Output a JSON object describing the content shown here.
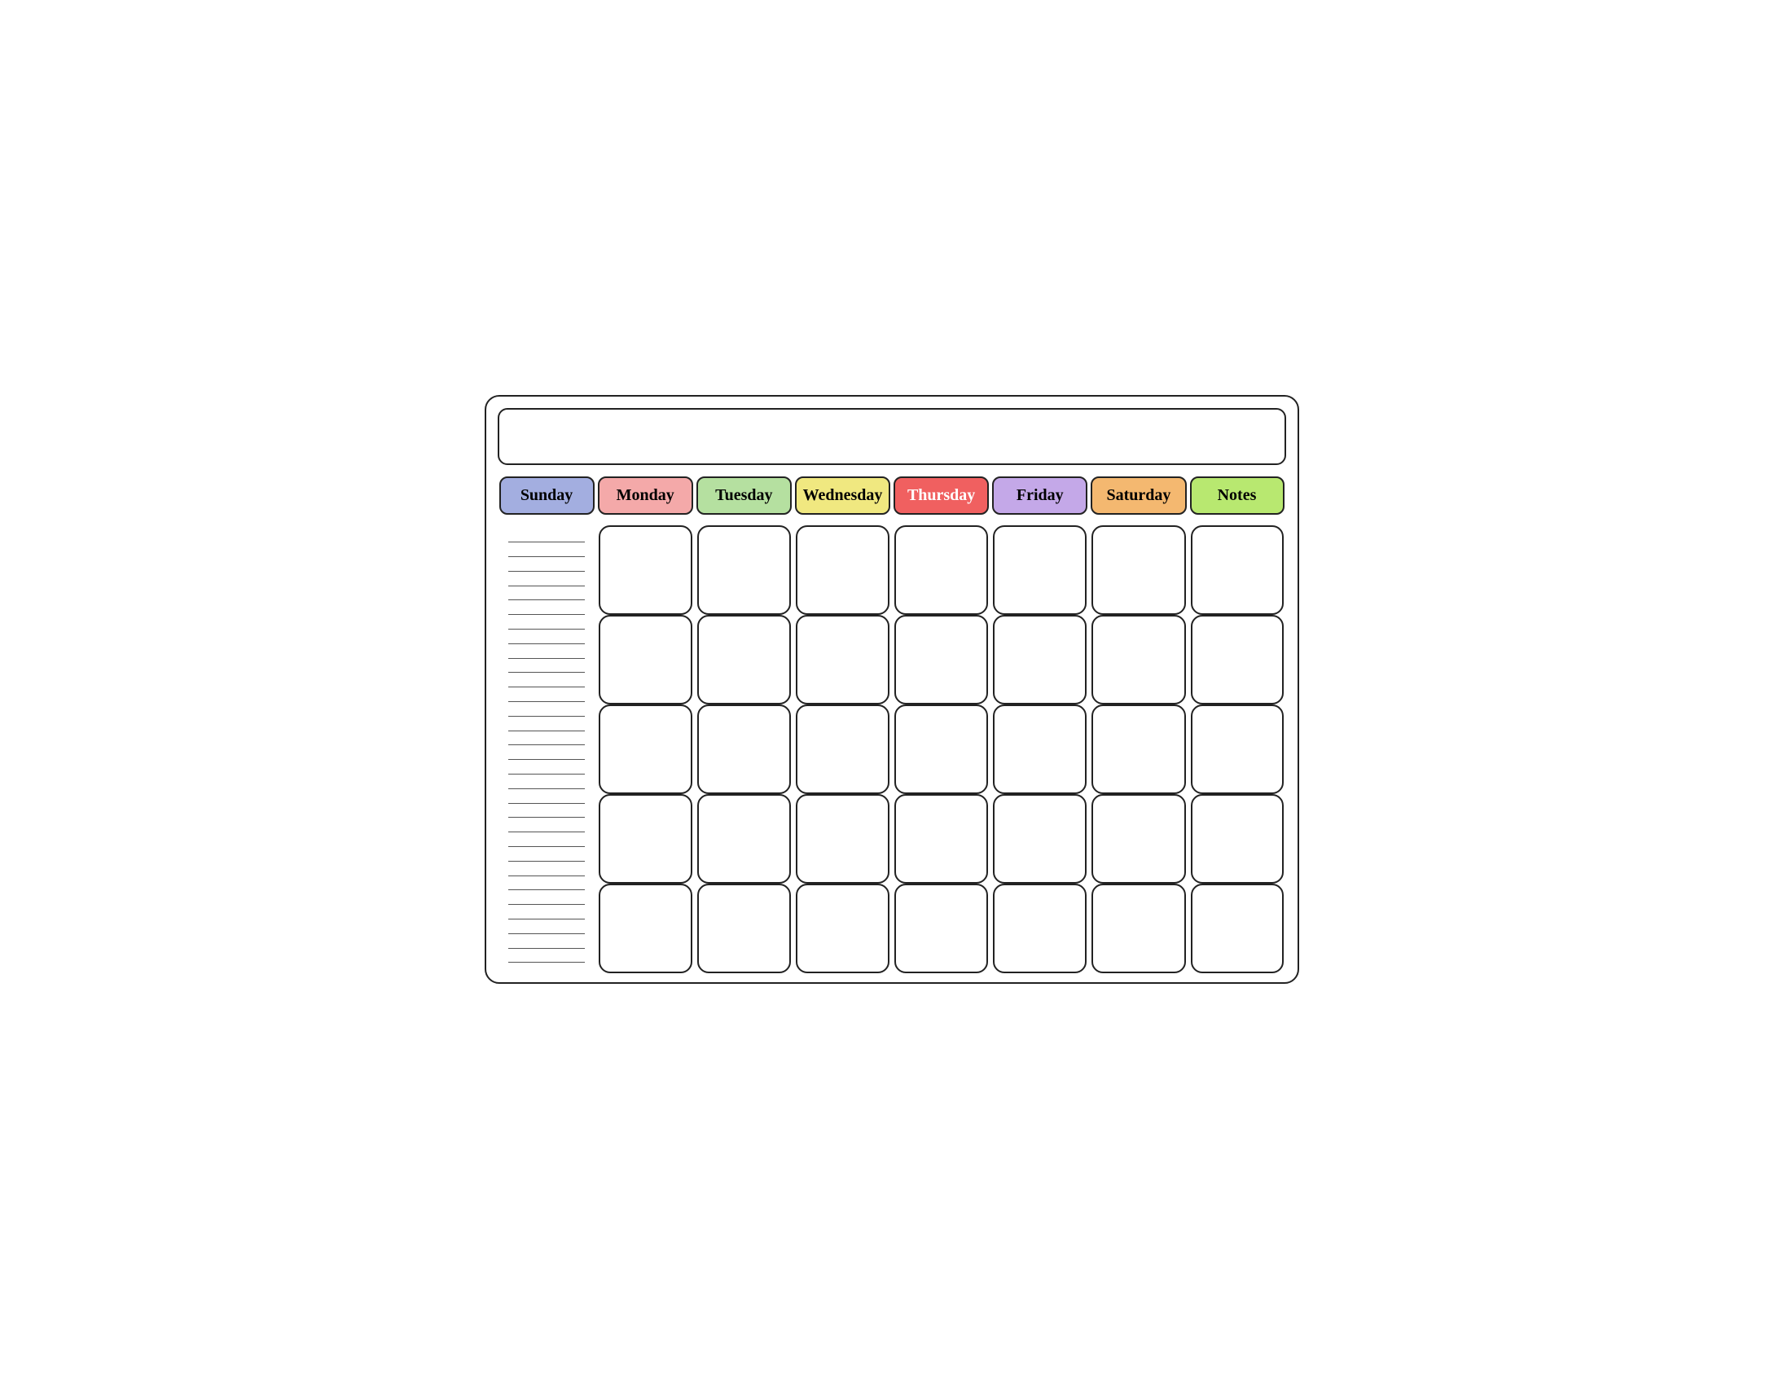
{
  "calendar": {
    "title": "",
    "headers": [
      {
        "id": "sunday",
        "label": "Sunday",
        "colorClass": "header-sunday"
      },
      {
        "id": "monday",
        "label": "Monday",
        "colorClass": "header-monday"
      },
      {
        "id": "tuesday",
        "label": "Tuesday",
        "colorClass": "header-tuesday"
      },
      {
        "id": "wednesday",
        "label": "Wednesday",
        "colorClass": "header-wednesday"
      },
      {
        "id": "thursday",
        "label": "Thursday",
        "colorClass": "header-thursday"
      },
      {
        "id": "friday",
        "label": "Friday",
        "colorClass": "header-friday"
      },
      {
        "id": "saturday",
        "label": "Saturday",
        "colorClass": "header-saturday"
      },
      {
        "id": "notes",
        "label": "Notes",
        "colorClass": "header-notes"
      }
    ],
    "rows": 5,
    "cols": 7,
    "notesLines": 30
  }
}
